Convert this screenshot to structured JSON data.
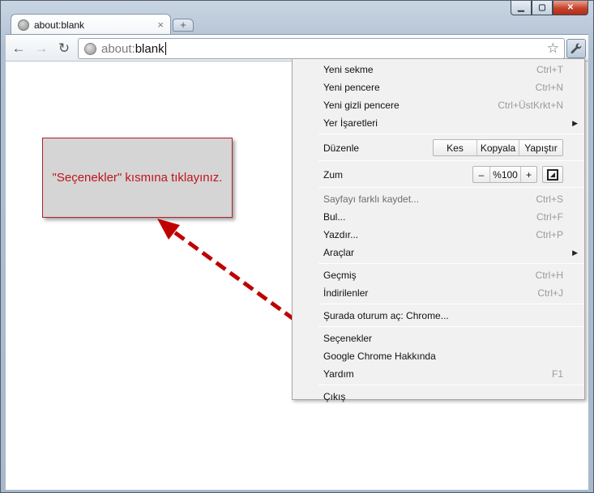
{
  "tab": {
    "title": "about:blank",
    "close": "×",
    "new_tab": "+"
  },
  "toolbar": {
    "back": "←",
    "forward": "→",
    "reload": "↻",
    "url_scheme": "about:",
    "url_host": "blank",
    "star": "☆"
  },
  "callout": {
    "text": "\"Seçenekler\" kısmına tıklayınız.",
    "color": "#c0141c"
  },
  "menu": {
    "items": [
      {
        "label": "Yeni sekme",
        "accel": "Ctrl+T"
      },
      {
        "label": "Yeni pencere",
        "accel": "Ctrl+N"
      },
      {
        "label": "Yeni gizli pencere",
        "accel": "Ctrl+ÜstKrkt+N"
      },
      {
        "label": "Yer İşaretleri",
        "accel": ""
      },
      {
        "label": "Düzenle",
        "accel": ""
      },
      {
        "label": "Zum",
        "accel": ""
      },
      {
        "label": "Sayfayı farklı kaydet...",
        "accel": "Ctrl+S"
      },
      {
        "label": "Bul...",
        "accel": "Ctrl+F"
      },
      {
        "label": "Yazdır...",
        "accel": "Ctrl+P"
      },
      {
        "label": "Araçlar",
        "accel": ""
      },
      {
        "label": "Geçmiş",
        "accel": "Ctrl+H"
      },
      {
        "label": "İndirilenler",
        "accel": "Ctrl+J"
      },
      {
        "label": "Şurada oturum aç: Chrome...",
        "accel": ""
      },
      {
        "label": "Seçenekler",
        "accel": ""
      },
      {
        "label": "Google Chrome Hakkında",
        "accel": ""
      },
      {
        "label": "Yardım",
        "accel": "F1"
      },
      {
        "label": "Çıkış",
        "accel": ""
      }
    ],
    "edit": {
      "cut": "Kes",
      "copy": "Kopyala",
      "paste": "Yapıştır"
    },
    "zoom": {
      "minus": "–",
      "level": "%100",
      "plus": "+"
    }
  },
  "colors": {
    "accent_red": "#c00000",
    "menu_bg": "#f1f1f1"
  }
}
